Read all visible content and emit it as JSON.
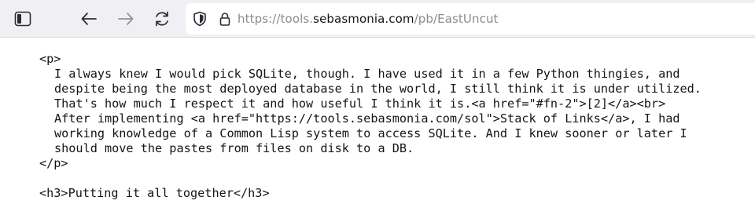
{
  "browser": {
    "url_prefix": "https://tools.",
    "url_domain": "sebasmonia.com",
    "url_path": "/pb/EastUncut"
  },
  "source": {
    "open_p": "<p>",
    "lines": [
      "I always knew I would pick SQLite, though. I have used it in a few Python thingies, and",
      "despite being the most deployed database in the world, I still think it is under utilized.",
      "That's how much I respect it and how useful I think it is.<a href=\"#fn-2\">[2]</a><br>",
      "After implementing <a href=\"https://tools.sebasmonia.com/sol\">Stack of Links</a>, I had",
      "working knowledge of a Common Lisp system to access SQLite. And I knew sooner or later I",
      "should move the pastes from files on disk to a DB."
    ],
    "close_p": "</p>",
    "heading": "<h3>Putting it all together</h3>"
  },
  "icons": {
    "sidebar": "sidebar-toggle-icon",
    "back": "back-arrow-icon",
    "forward": "forward-arrow-icon",
    "reload": "reload-icon",
    "shield": "tracking-shield-icon",
    "lock": "lock-icon"
  },
  "colors": {
    "toolbar_bg": "#f0f0f4",
    "text": "#15141a",
    "url_dim": "#8a8a92"
  }
}
